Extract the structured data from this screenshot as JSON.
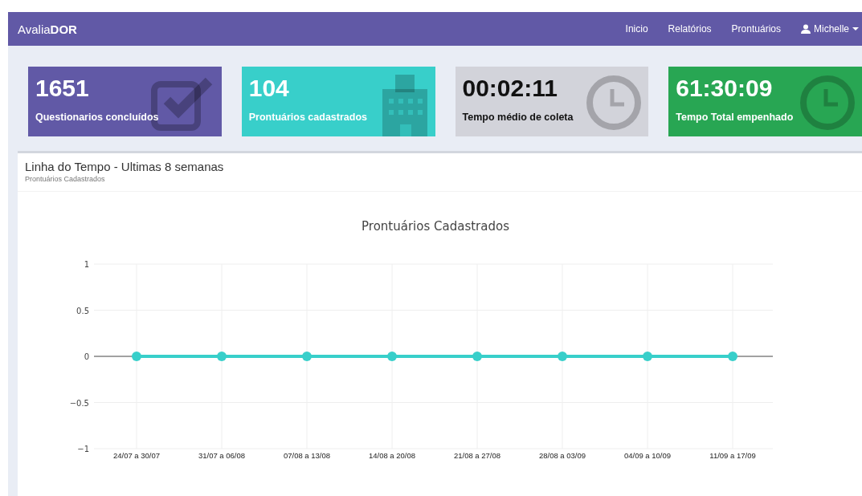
{
  "navbar": {
    "brand_prefix": "Avalia",
    "brand_bold": "DOR",
    "links": [
      "Inicio",
      "Relatórios",
      "Prontuários"
    ],
    "user": "Michelle"
  },
  "stats": [
    {
      "value": "1651",
      "label": "Questionarios concluídos",
      "color": "#6159a6",
      "kind": "check"
    },
    {
      "value": "104",
      "label": "Prontuários cadastrados",
      "color": "#38cfca",
      "kind": "building"
    },
    {
      "value": "00:02:11",
      "label": "Tempo médio de coleta",
      "color": "#d2d3da",
      "kind": "clock"
    },
    {
      "value": "61:30:09",
      "label": "Tempo Total empenhado",
      "color": "#28a653",
      "kind": "clock"
    }
  ],
  "panel": {
    "title": "Linha do Tempo - Ultimas 8 semanas",
    "subtitle": "Prontuários Cadastrados",
    "chart_data": {
      "type": "line",
      "title": "Prontuários Cadastrados",
      "categories": [
        "24/07 a 30/07",
        "31/07 a 06/08",
        "07/08 a 13/08",
        "14/08 a 20/08",
        "21/08 a 27/08",
        "28/08 a 03/09",
        "04/09 a 10/09",
        "11/09 a 17/09"
      ],
      "series": [
        {
          "color": "#38cfca",
          "marker": true,
          "values": [
            0,
            0,
            0,
            0,
            0,
            0,
            0,
            0
          ]
        }
      ],
      "grid": true,
      "ylim": [
        -1,
        1
      ],
      "yticks": [
        1,
        0.5,
        0,
        {
          "value": -0.5,
          "label": "−0.5"
        },
        {
          "value": -1,
          "label": "−1"
        }
      ]
    }
  }
}
